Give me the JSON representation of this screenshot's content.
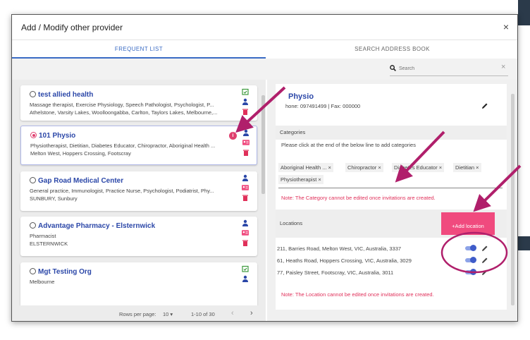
{
  "modal": {
    "title": "Add / Modify other provider",
    "close": "×"
  },
  "tabs": [
    {
      "label": "FREQUENT LIST",
      "active": true
    },
    {
      "label": "SEARCH ADDRESS BOOK",
      "active": false
    }
  ],
  "search": {
    "placeholder": "Search",
    "clear": "×"
  },
  "providers": [
    {
      "name": "test allied health",
      "selected": false,
      "line1": "Massage therapist, Exercise Physiology, Speech Pathologist, Psychologist, P...",
      "line2": "Athelstone, Varsity Lakes, Woolloongabba, Carlton, Taylors Lakes, Melbourne,..."
    },
    {
      "name": "101 Physio",
      "selected": true,
      "info": "i",
      "line1": "Physiotherapist, Dietitian, Diabetes Educator, Chiropractor, Aboriginal Health ...",
      "line2": "Melton West, Hoppers Crossing, Footscray"
    },
    {
      "name": "Gap Road Medical Center",
      "selected": false,
      "line1": "General practice, Immunologist, Practice Nurse, Psychologist, Podiatrist, Phy...",
      "line2": "SUNBURY, Sunbury"
    },
    {
      "name": "Advantage Pharmacy - Elsternwick",
      "selected": false,
      "line1": "Pharmacist",
      "line2": "ELSTERNWICK"
    },
    {
      "name": "Mgt Testing Org",
      "selected": false,
      "line1": "Melbourne",
      "line2": ""
    }
  ],
  "pager": {
    "rows_label": "Rows per page:",
    "rows_value": "10 ▾",
    "range": "1-10 of 30",
    "prev": "‹",
    "next": "›"
  },
  "detail": {
    "title": "Physio",
    "phone": "hone: 097491499 | Fax: 000000",
    "categories_label": "Categories",
    "hint": "Please click at the end of the below line to add categories",
    "chips": [
      "Aboriginal Health ... ×",
      "Chiropractor ×",
      "Diabetes Educator ×",
      "Dietitian ×",
      "Physiotherapist ×"
    ],
    "category_note": "Note: The Category cannot be edited once invitations are created.",
    "locations_label": "Locations",
    "add_location": "+Add location",
    "locations": [
      "211, Barries Road, Melton West, VIC, Australia, 3337",
      "61, Heaths Road, Hoppers Crossing, VIC, Australia, 3029",
      "77, Paisley Street, Footscray, VIC, Australia, 3011"
    ],
    "location_note": "Note: The Location cannot be edited once invitations are created."
  },
  "colors": {
    "accent": "#2b47a8",
    "pink": "#f04a7e",
    "green": "#3c9a3c",
    "red": "#e0305a",
    "annotation": "#b01f6b"
  },
  "icons": [
    "search-icon",
    "calendar-check-icon",
    "person-icon",
    "id-card-icon",
    "trash-icon",
    "pencil-icon",
    "toggle-on-icon"
  ]
}
